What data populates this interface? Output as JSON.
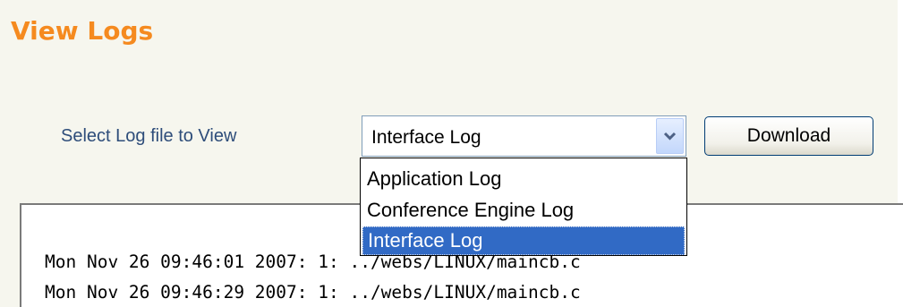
{
  "page": {
    "title": "View Logs"
  },
  "log_selector": {
    "label": "Select Log file to View",
    "selected_value": "Interface Log",
    "options": [
      "Application Log",
      "Conference Engine Log",
      "Interface Log"
    ],
    "arrow_icon": "chevron-down-icon",
    "download_label": "Download"
  },
  "log_viewer": {
    "lines": [
      "Mon Nov 26 09:46:01 2007: 1: ../webs/LINUX/maincb.c",
      "Mon Nov 26 09:46:29 2007: 1: ../webs/LINUX/maincb.c"
    ]
  },
  "colors": {
    "title": "#f58a1f",
    "label": "#2e4d7a",
    "highlight": "#316ac5"
  }
}
